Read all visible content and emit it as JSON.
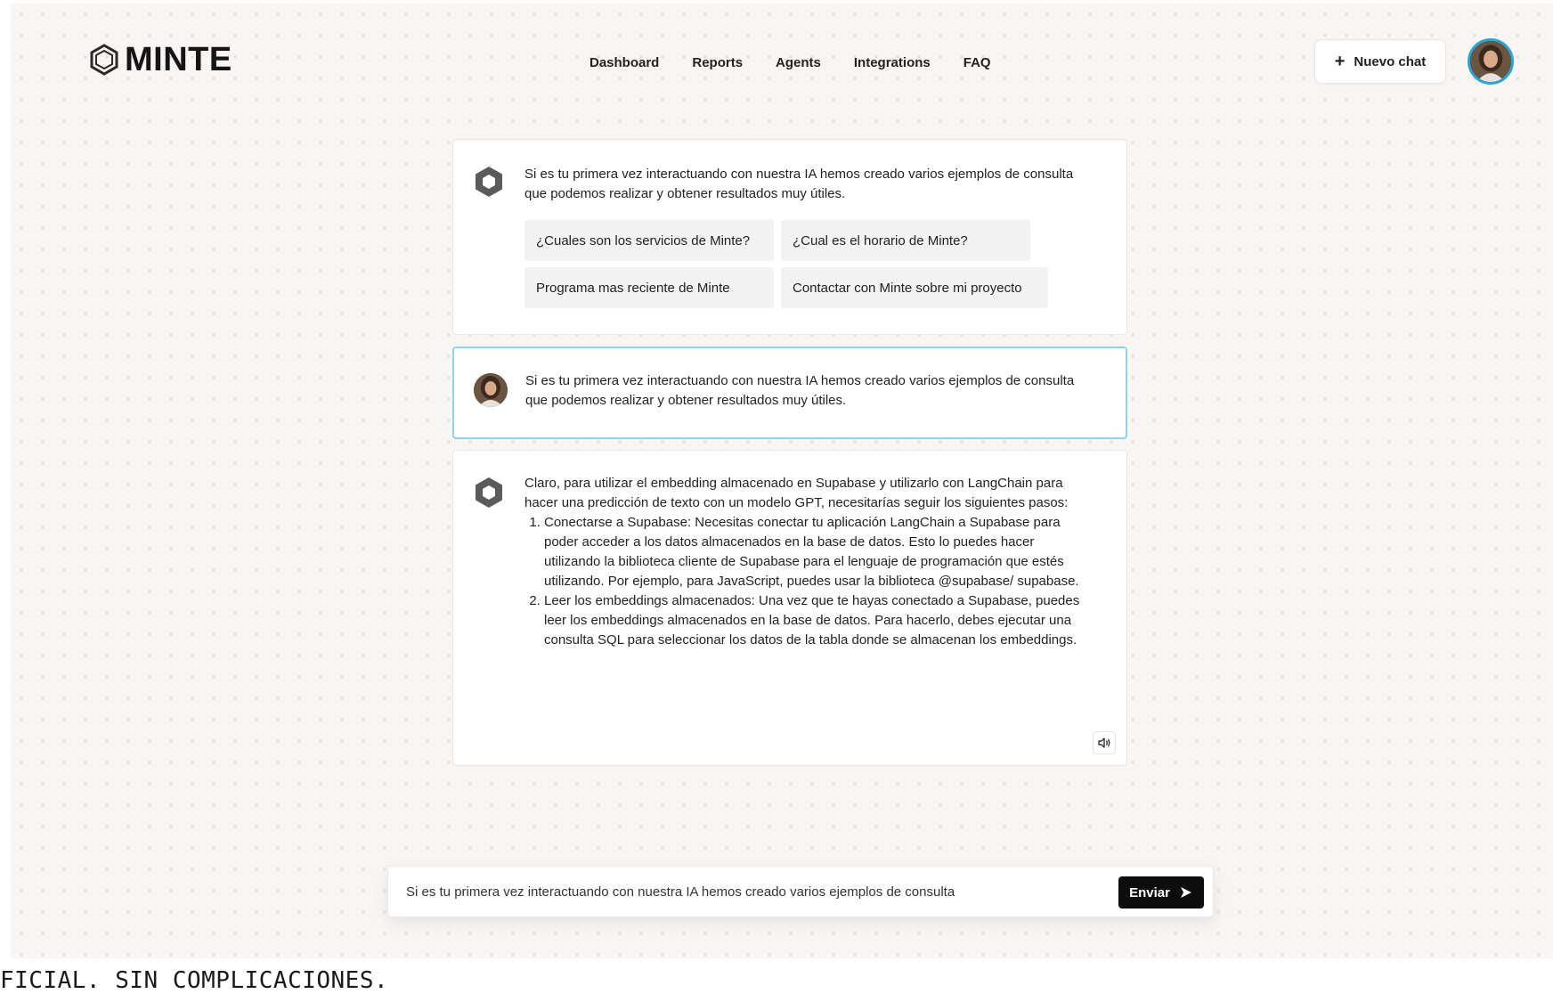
{
  "brand": {
    "name": "MINTE",
    "logo_icon": "hexagon-logo-icon"
  },
  "nav": [
    "Dashboard",
    "Reports",
    "Agents",
    "Integrations",
    "FAQ"
  ],
  "header": {
    "new_chat_label": "Nuevo chat",
    "new_chat_icon": "plus-icon",
    "avatar": "user-avatar"
  },
  "chat": {
    "welcome": {
      "text": "Si es tu primera vez interactuando con nuestra IA hemos creado varios ejemplos de consulta que podemos realizar y obtener resultados muy útiles.",
      "suggestions": [
        "¿Cuales son los servicios de Minte?",
        "¿Cual es el horario de Minte?",
        "Programa mas reciente de Minte",
        "Contactar con Minte sobre mi proyecto"
      ]
    },
    "user_message": {
      "text": "Si es tu primera vez interactuando con nuestra IA hemos creado varios ejemplos de consulta que podemos realizar y obtener resultados muy útiles."
    },
    "bot_answer": {
      "intro": "Claro, para utilizar el embedding almacenado en Supabase y utilizarlo con LangChain para hacer una predicción de texto con un modelo GPT, necesitarías seguir los siguientes pasos:",
      "steps": [
        "Conectarse a Supabase: Necesitas conectar tu aplicación LangChain a Supabase para poder acceder a los datos almacenados en la base de datos. Esto lo puedes hacer utilizando la biblioteca cliente de Supabase para el lenguaje de programación que estés utilizando. Por ejemplo, para JavaScript, puedes usar la biblioteca @supabase/ supabase.",
        "Leer los embeddings almacenados: Una vez que te hayas conectado a Supabase, puedes leer los embeddings almacenados en la base de datos. Para hacerlo, debes ejecutar una consulta SQL para seleccionar los datos de la tabla donde se almacenan los embeddings."
      ],
      "speaker_icon": "speaker-icon"
    }
  },
  "composer": {
    "placeholder": "Si es tu primera vez interactuando con nuestra IA hemos creado varios ejemplos de consulta",
    "send_label": "Enviar",
    "send_icon": "arrow-right-icon"
  },
  "tagline": "FICIAL. SIN COMPLICACIONES.",
  "colors": {
    "background": "#f8f5f2",
    "accent": "#27a7d6",
    "user_border": "#8fd3e8",
    "button": "#0d0d0d"
  }
}
